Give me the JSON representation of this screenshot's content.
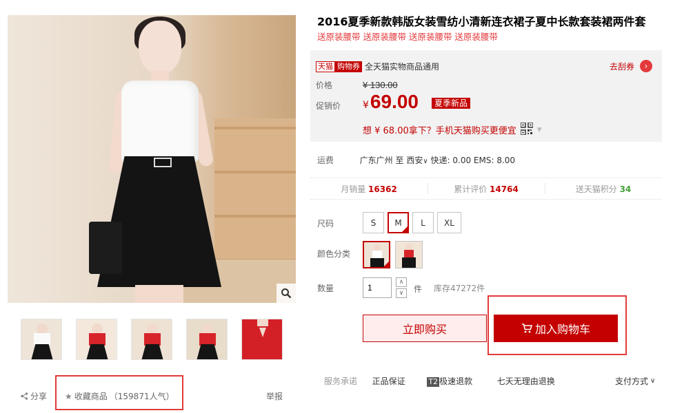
{
  "product": {
    "title": "2016夏季新款韩版女装雪纺小清新连衣裙子夏中长款套装裙两件套",
    "subtitle": "送原装腰带 送原装腰带 送原装腰带 送原装腰带"
  },
  "gallery": {
    "thumbnail_count": 5,
    "share_label": "分享",
    "favorite_label": "收藏商品",
    "favorite_count": "（159871人气）",
    "report_label": "举报"
  },
  "coupon": {
    "tmall_tag": "天猫",
    "voucher_tag": "购物券",
    "text": "全天猫实物商品通用",
    "link": "去刮券"
  },
  "price": {
    "original_label": "价格",
    "original_currency": "¥",
    "original_value": "130.00",
    "promo_label": "促销价",
    "promo_currency": "¥",
    "promo_value": "69.00",
    "promo_badge": "夏季新品",
    "mobile_text": "想 ¥ 68.00拿下？手机天猫购买更便宜"
  },
  "shipping": {
    "label": "运费",
    "from": "广东广州",
    "to_word": "至",
    "to": "西安",
    "fees": "快递: 0.00 EMS: 8.00"
  },
  "stats": {
    "monthly_label": "月销量",
    "monthly_value": "16362",
    "reviews_label": "累计评价",
    "reviews_value": "14764",
    "points_label": "送天猫积分",
    "points_value": "34"
  },
  "options": {
    "size_label": "尺码",
    "sizes": [
      "S",
      "M",
      "L",
      "XL"
    ],
    "selected_size": "M",
    "color_label": "颜色分类",
    "quantity_label": "数量",
    "quantity_value": "1",
    "quantity_unit": "件",
    "stock": "库存47272件"
  },
  "actions": {
    "buy_now": "立即购买",
    "add_to_cart": "加入购物车"
  },
  "service": {
    "label": "服务承诺",
    "genuine": "正品保证",
    "t2_tag": "T2",
    "fast_refund": "极速退款",
    "seven_day": "七天无理由退换",
    "payment": "支付方式"
  },
  "colors": {
    "accent": "#c40000",
    "link_red": "#e4393c",
    "points_green": "#44a03a",
    "highlight_box": "#e23a3a"
  }
}
